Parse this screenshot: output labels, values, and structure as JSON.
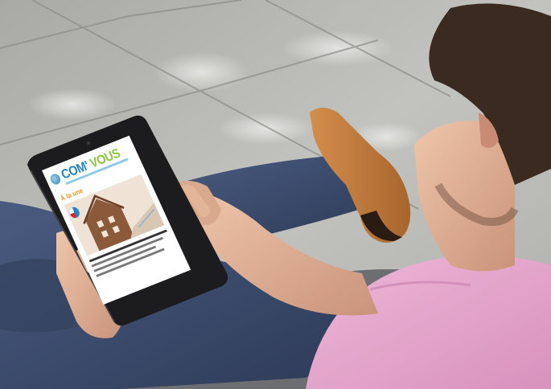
{
  "photo": {
    "description_hidden": "",
    "tablet": {
      "magazine": {
        "title_main": "COM'",
        "title_second": "VOUS",
        "section_label": "À la une"
      }
    }
  },
  "colors": {
    "pavement": "#b9b9b6",
    "jeans": "#3e4f72",
    "shirt": "#e7a8cf",
    "skin": "#e3b89c",
    "hair": "#3a2a20",
    "shoe": "#c07a3c",
    "tablet_frame": "#1c1c1e",
    "accent_blue": "#1f86c6",
    "accent_orange": "#f29120"
  }
}
